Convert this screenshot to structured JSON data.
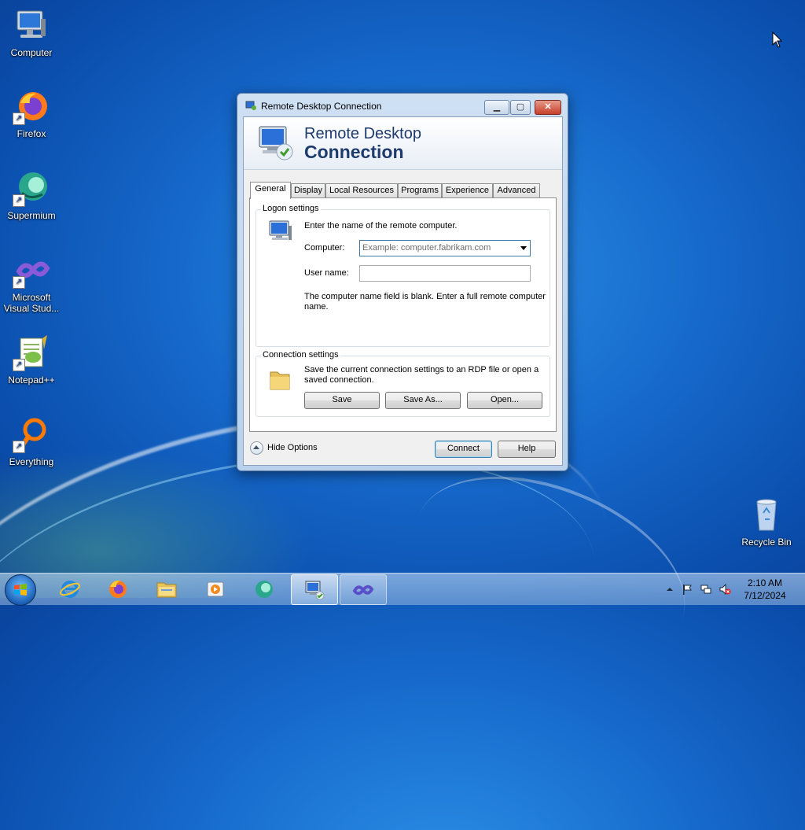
{
  "desktop": {
    "icons": [
      {
        "label": "Computer",
        "icon": "computer-icon"
      },
      {
        "label": "Firefox",
        "icon": "firefox-icon"
      },
      {
        "label": "Supermium",
        "icon": "supermium-icon"
      },
      {
        "label": "Microsoft Visual Stud...",
        "label_line1": "Microsoft",
        "label_line2": "Visual Stud...",
        "icon": "visual-studio-icon"
      },
      {
        "label": "Notepad++",
        "icon": "notepadpp-icon"
      },
      {
        "label": "Everything",
        "icon": "everything-icon"
      },
      {
        "label": "Recycle Bin",
        "icon": "recycle-bin-icon"
      }
    ]
  },
  "window": {
    "title": "Remote Desktop Connection",
    "banner_line1": "Remote Desktop",
    "banner_line2": "Connection",
    "tabs": [
      {
        "label": "General",
        "active": true
      },
      {
        "label": "Display"
      },
      {
        "label": "Local Resources"
      },
      {
        "label": "Programs"
      },
      {
        "label": "Experience"
      },
      {
        "label": "Advanced"
      }
    ],
    "logon": {
      "group_label": "Logon settings",
      "intro": "Enter the name of the remote computer.",
      "computer_label": "Computer:",
      "computer_placeholder": "Example: computer.fabrikam.com",
      "computer_value": "",
      "username_label": "User name:",
      "username_value": "",
      "message": "The computer name field is blank. Enter a full remote computer name."
    },
    "connection": {
      "group_label": "Connection settings",
      "description": "Save the current connection settings to an RDP file or open a saved connection.",
      "save_label": "Save",
      "save_as_label": "Save As...",
      "open_label": "Open..."
    },
    "hide_options_label": "Hide Options",
    "connect_label": "Connect",
    "help_label": "Help"
  },
  "taskbar": {
    "items": [
      "internet-explorer-icon",
      "firefox-icon",
      "file-explorer-icon",
      "media-player-icon",
      "supermium-icon",
      "remote-desktop-icon",
      "visual-studio-icon"
    ],
    "time": "2:10 AM",
    "date": "7/12/2024"
  }
}
